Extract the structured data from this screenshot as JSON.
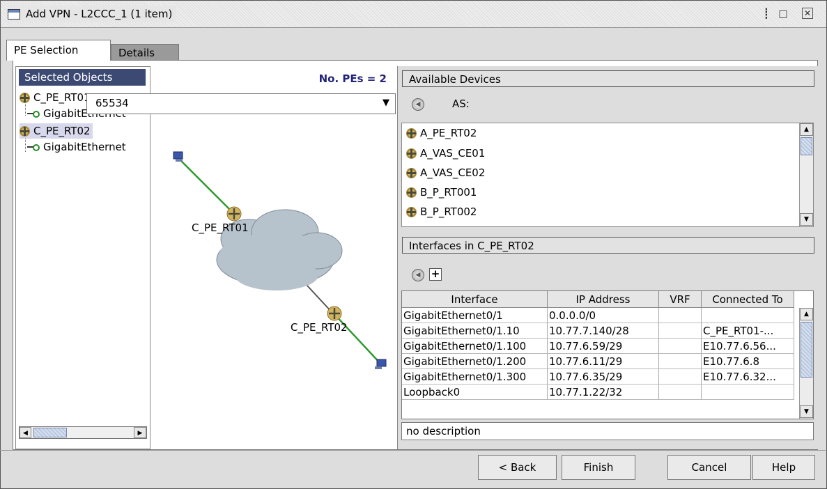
{
  "window": {
    "title": "Add VPN - L2CCC_1 (1 item)"
  },
  "tabs": [
    {
      "label": "PE Selection"
    },
    {
      "label": "Details"
    }
  ],
  "selected_objects": {
    "header": "Selected Objects",
    "items": [
      {
        "name": "C_PE_RT01",
        "interface": "GigabitEthernet"
      },
      {
        "name": "C_PE_RT02",
        "interface": "GigabitEthernet"
      }
    ]
  },
  "canvas": {
    "pe_count_label": "No. PEs = 2",
    "nodes": [
      {
        "label": "C_PE_RT01"
      },
      {
        "label": "C_PE_RT02"
      }
    ]
  },
  "available_devices": {
    "header": "Available Devices",
    "as_label": "AS:",
    "as_value": "65534",
    "devices": [
      "A_PE_RT02",
      "A_VAS_CE01",
      "A_VAS_CE02",
      "B_P_RT001",
      "B_P_RT002"
    ]
  },
  "interfaces": {
    "header": "Interfaces in C_PE_RT02",
    "columns": [
      "Interface",
      "IP Address",
      "VRF",
      "Connected To"
    ],
    "rows": [
      {
        "interface": "GigabitEthernet0/1",
        "ip": "0.0.0.0/0",
        "vrf": "",
        "connected": ""
      },
      {
        "interface": "GigabitEthernet0/1.10",
        "ip": "10.77.7.140/28",
        "vrf": "",
        "connected": "C_PE_RT01-..."
      },
      {
        "interface": "GigabitEthernet0/1.100",
        "ip": "10.77.6.59/29",
        "vrf": "",
        "connected": "E10.77.6.56..."
      },
      {
        "interface": "GigabitEthernet0/1.200",
        "ip": "10.77.6.11/29",
        "vrf": "",
        "connected": "E10.77.6.8"
      },
      {
        "interface": "GigabitEthernet0/1.300",
        "ip": "10.77.6.35/29",
        "vrf": "",
        "connected": "E10.77.6.32..."
      },
      {
        "interface": "Loopback0",
        "ip": "10.77.1.22/32",
        "vrf": "",
        "connected": ""
      }
    ]
  },
  "description": "no description",
  "buttons": {
    "back": "< Back",
    "finish": "Finish",
    "cancel": "Cancel",
    "help": "Help"
  },
  "colors": {
    "header_navy": "#3c4a73",
    "link_green": "#2e9a2e",
    "cloud": "#b7c3cc",
    "pe_count": "#23237a"
  }
}
